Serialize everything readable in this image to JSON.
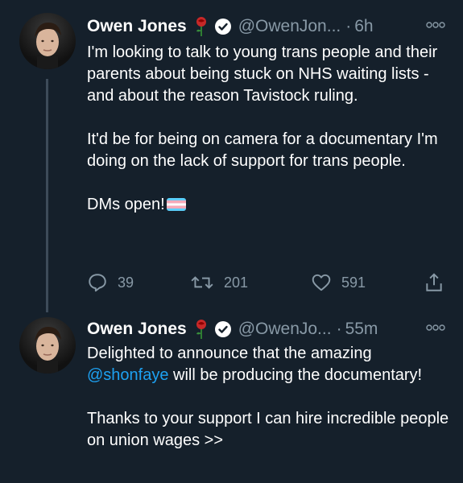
{
  "tweets": [
    {
      "author": {
        "name": "Owen Jones",
        "emoji": "rose",
        "verified": true,
        "handle": "@OwenJon...",
        "time_sep": "·",
        "time": "6h"
      },
      "icons": [
        "avatar",
        "rose-icon",
        "verified-icon",
        "more-icon"
      ],
      "body": {
        "para1": "I'm looking to talk to young trans people and their parents about being stuck on NHS waiting lists - and about the reason Tavistock ruling.",
        "para2": "It'd be for being on camera for a documentary I'm doing on the lack of support for trans people.",
        "para3": "DMs open!"
      },
      "actions": {
        "replies": "39",
        "retweets": "201",
        "likes": "591"
      }
    },
    {
      "author": {
        "name": "Owen Jones",
        "emoji": "rose",
        "verified": true,
        "handle": "@OwenJo...",
        "time_sep": "·",
        "time": "55m"
      },
      "body": {
        "para1_pre": "Delighted to announce that the amazing",
        "mention": "@shonfaye",
        "para1_post": " will be producing the documentary!",
        "para2": "Thanks to your support I can hire incredible people on union wages >>"
      }
    }
  ],
  "colors": {
    "background": "#15202b",
    "secondary_text": "#8899a6",
    "link": "#1da1f2",
    "thread_line": "#3d4b59"
  }
}
